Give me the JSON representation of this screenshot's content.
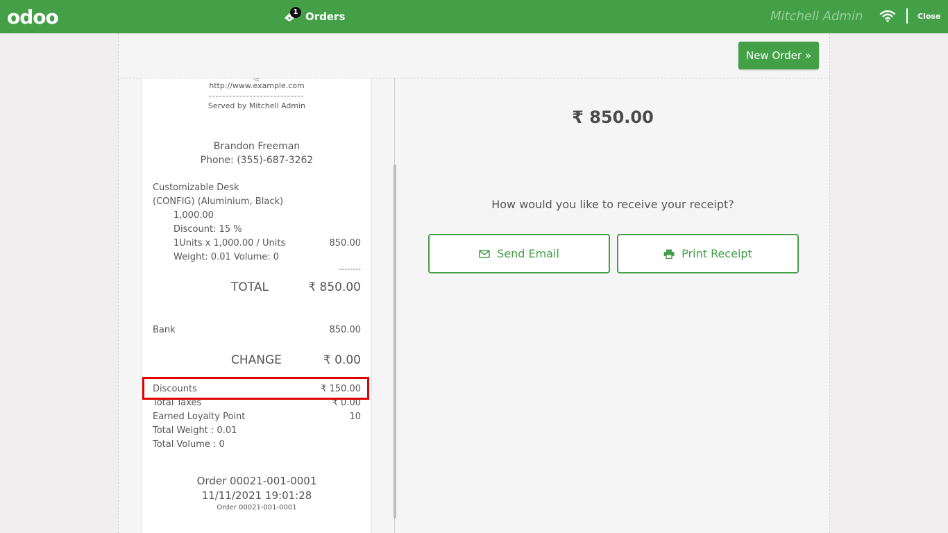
{
  "topbar": {
    "logo": "odoo",
    "orders_label": "Orders",
    "orders_count": "1",
    "user": "Mitchell Admin",
    "close": "Close"
  },
  "actions": {
    "new_order": "New Order »"
  },
  "receipt": {
    "website": "http://www.example.com",
    "separator": "--------------------------------",
    "served_by": "Served by Mitchell Admin",
    "customer_name": "Brandon Freeman",
    "customer_phone": "Phone: (355)-687-3262",
    "product_name": "Customizable Desk",
    "product_variant": "(CONFIG) (Aluminium, Black)",
    "product_price": "1,000.00",
    "product_discount": "Discount: 15 %",
    "product_qty": "1Units x 1,000.00 / Units",
    "product_total": "850.00",
    "product_weight": "Weight: 0.01 Volume: 0",
    "total_sep": "--------",
    "total_label": "TOTAL",
    "total_value": "₹ 850.00",
    "payment_method": "Bank",
    "payment_amount": "850.00",
    "change_label": "CHANGE",
    "change_value": "₹ 0.00",
    "discounts_label": "Discounts",
    "discounts_value": "₹ 150.00",
    "taxes_label": "Total Taxes",
    "taxes_value": "₹ 0.00",
    "loyalty_label": "Earned Loyalty Point",
    "loyalty_value": "10",
    "total_weight": "Total Weight : 0.01",
    "total_volume": "Total Volume : 0",
    "order_ref": "Order 00021-001-0001",
    "order_date": "11/11/2021 19:01:28",
    "order_ref_small": "Order 00021-001-0001"
  },
  "payment": {
    "amount": "₹ 850.00",
    "question": "How would you like to receive your receipt?",
    "send_email": "Send Email",
    "print_receipt": "Print Receipt"
  },
  "icons": {
    "orders": "ticket-icon",
    "wifi": "wifi-icon",
    "email": "envelope-icon",
    "print": "printer-icon"
  },
  "colors": {
    "brand_green": "#43a047",
    "highlight_red": "#e00000"
  }
}
